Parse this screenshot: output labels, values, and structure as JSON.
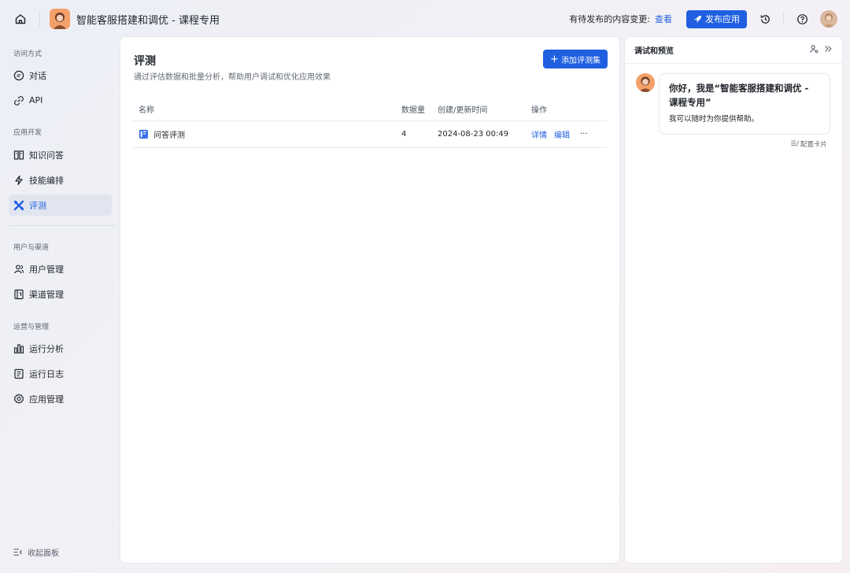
{
  "header": {
    "app_title": "智能客服搭建和调优 - 课程专用",
    "pending_text": "有待发布的内容变更:",
    "view_label": "查看",
    "publish_label": "发布应用"
  },
  "sidebar": {
    "sections": [
      {
        "title": "访问方式"
      },
      {
        "title": "应用开发"
      },
      {
        "title": "用户与渠道"
      },
      {
        "title": "运营与管理"
      }
    ],
    "items": [
      {
        "label": "对话"
      },
      {
        "label": "API"
      },
      {
        "label": "知识问答"
      },
      {
        "label": "技能编排"
      },
      {
        "label": "评测"
      },
      {
        "label": "用户管理"
      },
      {
        "label": "渠道管理"
      },
      {
        "label": "运行分析"
      },
      {
        "label": "运行日志"
      },
      {
        "label": "应用管理"
      }
    ],
    "collapse_label": "收起面板"
  },
  "main": {
    "title": "评测",
    "description": "通过评估数据和批量分析，帮助用户调试和优化应用效果",
    "add_button": "添加评测集",
    "columns": [
      "名称",
      "数据量",
      "创建/更新时间",
      "操作"
    ],
    "rows": [
      {
        "name": "问答评测",
        "count": "4",
        "time": "2024-08-23 00:49",
        "detail": "详情",
        "edit": "编辑",
        "more": "···"
      }
    ]
  },
  "panel": {
    "title": "调试和预览",
    "greeting": "你好，我是“智能客服搭建和调优 - 课程专用”",
    "sub": "我可以随时为你提供帮助。",
    "config_card": "配置卡片"
  },
  "colors": {
    "accent": "#1f5fe0"
  }
}
